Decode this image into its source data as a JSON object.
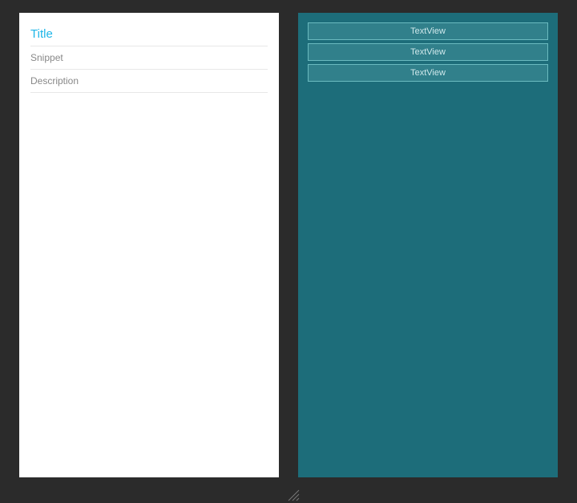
{
  "left_panel": {
    "title": "Title",
    "snippet": "Snippet",
    "description": "Description"
  },
  "right_panel": {
    "rows": [
      {
        "label": "TextView"
      },
      {
        "label": "TextView"
      },
      {
        "label": "TextView"
      }
    ]
  }
}
